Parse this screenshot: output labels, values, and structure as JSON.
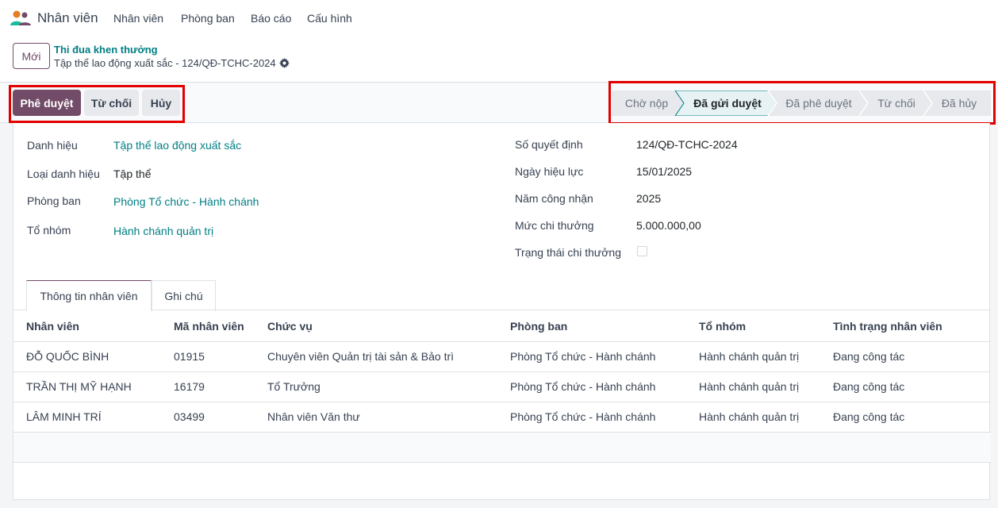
{
  "app": {
    "name": "Nhân viên",
    "menu": [
      "Nhân viên",
      "Phòng ban",
      "Báo cáo",
      "Cấu hình"
    ]
  },
  "control": {
    "new_button": "Mới",
    "breadcrumb_parent": "Thi đua khen thưởng",
    "breadcrumb_current": "Tập thể lao động xuất sắc - 124/QĐ-TCHC-2024"
  },
  "actions": {
    "approve": "Phê duyệt",
    "reject": "Từ chối",
    "cancel": "Hủy"
  },
  "stages": {
    "items": [
      "Chờ nộp",
      "Đã gửi duyệt",
      "Đã phê duyệt",
      "Từ chối",
      "Đã hủy"
    ],
    "current": "Đã gửi duyệt"
  },
  "form": {
    "left": [
      {
        "label": "Danh hiệu",
        "value": "Tập thể lao động xuất sắc"
      },
      {
        "label": "Loại danh hiệu",
        "value": "Tập thể"
      },
      {
        "label": "Phòng ban",
        "value": "Phòng Tổ chức - Hành chánh"
      },
      {
        "label": "Tổ nhóm",
        "value": "Hành chánh quản trị"
      }
    ],
    "right": [
      {
        "label": "Số quyết định",
        "value": "124/QĐ-TCHC-2024"
      },
      {
        "label": "Ngày hiệu lực",
        "value": "15/01/2025"
      },
      {
        "label": "Năm công nhận",
        "value": "2025"
      },
      {
        "label": "Mức chi thưởng",
        "value": "5.000.000,00"
      },
      {
        "label": "Trạng thái chi thưởng",
        "checked": false
      }
    ]
  },
  "tabs": [
    "Thông tin nhân viên",
    "Ghi chú"
  ],
  "table": {
    "headers": [
      "Nhân viên",
      "Mã nhân viên",
      "Chức vụ",
      "Phòng ban",
      "Tổ nhóm",
      "Tình trạng nhân viên"
    ],
    "rows": [
      [
        "ĐỖ QUỐC BÌNH",
        "01915",
        "Chuyên viên Quản trị tài sản & Bảo trì",
        "Phòng Tổ chức - Hành chánh",
        "Hành chánh quản trị",
        "Đang công tác"
      ],
      [
        "TRẦN THỊ MỸ HẠNH",
        "16179",
        "Tổ Trưởng",
        "Phòng Tổ chức - Hành chánh",
        "Hành chánh quản trị",
        "Đang công tác"
      ],
      [
        "LÂM MINH TRÍ",
        "03499",
        "Nhân viên Văn thư",
        "Phòng Tổ chức - Hành chánh",
        "Hành chánh quản trị",
        "Đang công tác"
      ]
    ]
  },
  "colors": {
    "primary": "#714b67",
    "link": "#017e84",
    "highlight_box": "#e10000",
    "current_stage_border": "#017e84"
  }
}
